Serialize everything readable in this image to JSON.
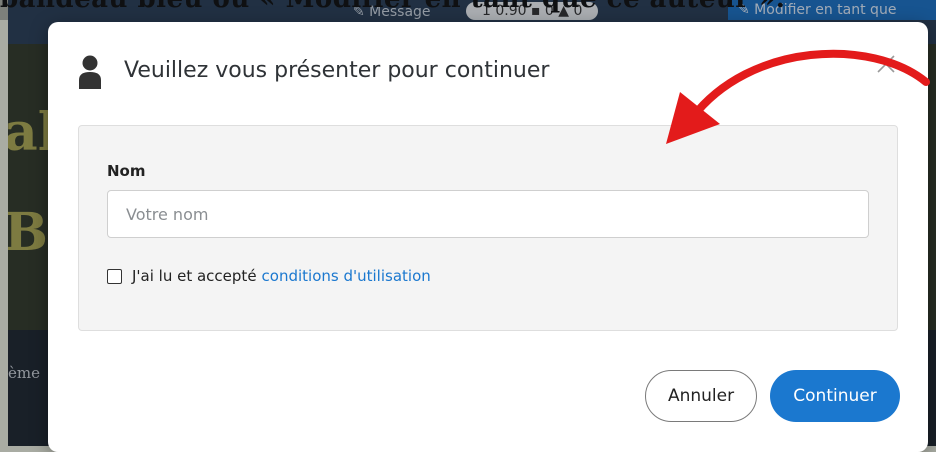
{
  "background": {
    "top_caption": "bandeau bleu ou « Modifier en tant que ce auteur ».",
    "nav": {
      "message_label": "✎ Message",
      "stats_label": "1 0.90  ▪ 0  ▲ 0",
      "edit_label": "✎ Modifier en tant que"
    },
    "banner_line1": "al",
    "banner_line2": "Bè",
    "strip_label": "ème"
  },
  "modal": {
    "title": "Veuillez vous présenter pour continuer",
    "close_glyph": "×",
    "form": {
      "name_label": "Nom",
      "name_value": "",
      "name_placeholder": "Votre nom",
      "terms_checked": false,
      "terms_text": "J'ai lu et accepté",
      "terms_link": "conditions d'utilisation"
    },
    "buttons": {
      "cancel": "Annuler",
      "continue": "Continuer"
    }
  },
  "colors": {
    "primary": "#1b78cf",
    "arrow": "#e31b1b",
    "panel_bg": "#f4f4f4",
    "title_text": "#2f3337"
  },
  "icons": {
    "user": "user-icon",
    "close": "close-icon",
    "arrow": "curved-arrow-annotation"
  }
}
